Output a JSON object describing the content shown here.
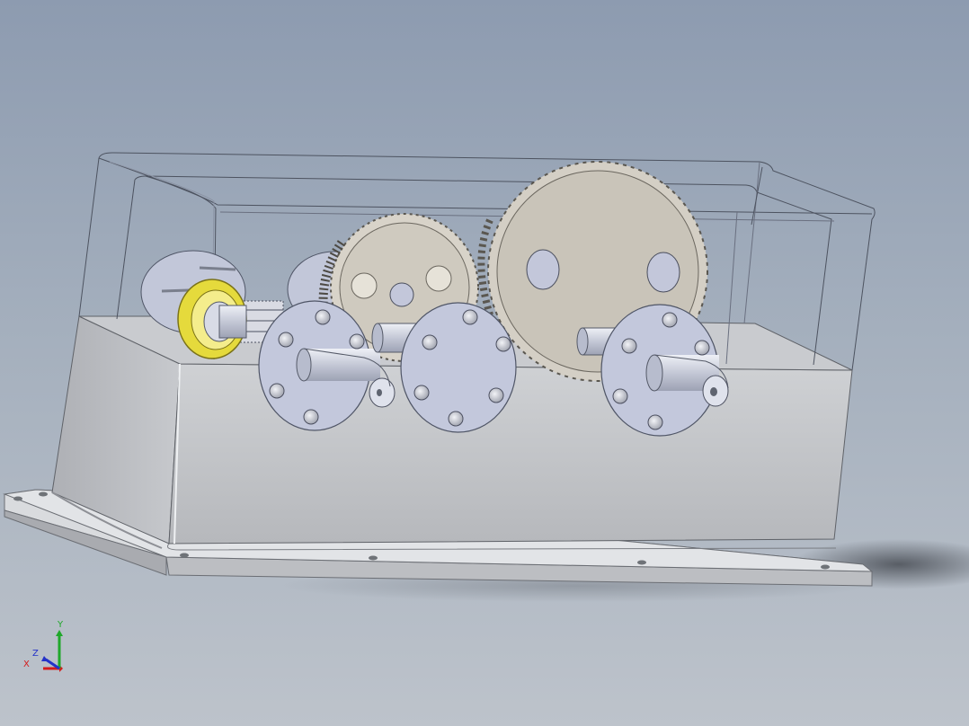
{
  "triad": {
    "x_label": "X",
    "y_label": "Y",
    "z_label": "Z",
    "colors": {
      "x": "#d41b1b",
      "y": "#1fa82a",
      "z": "#2432c8"
    }
  },
  "colors": {
    "background_top": "#8d9bb0",
    "background_bottom": "#bdc3cb",
    "housing": "#c6c8cc",
    "gear": "#d6d1c7",
    "bearing": "#e6dc3a",
    "flange": "#c3c8dc"
  }
}
